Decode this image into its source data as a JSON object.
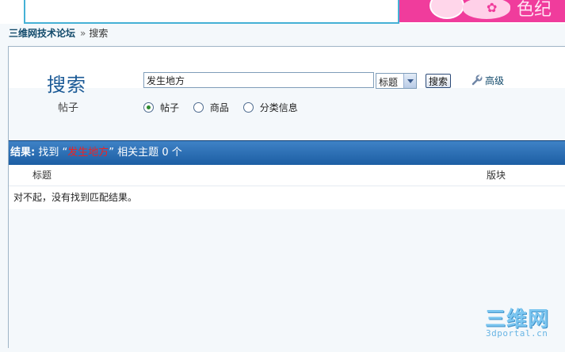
{
  "banner": {
    "right_text": "色纪佳"
  },
  "breadcrumb": {
    "forum": "三维网技术论坛",
    "separator": "»",
    "current": "搜索"
  },
  "search": {
    "title": "搜索",
    "subtitle": "帖子",
    "keyword": "发生地方",
    "field_selected": "标题",
    "button_label": "搜索",
    "advanced_label": "高级",
    "types": [
      {
        "label": "帖子",
        "checked": true
      },
      {
        "label": "商品",
        "checked": false
      },
      {
        "label": "分类信息",
        "checked": false
      }
    ]
  },
  "results": {
    "label": "结果:",
    "found": "找到",
    "open_quote": "“",
    "keyword": "发生地方",
    "close_quote": "”",
    "suffix": "相关主题",
    "count": "0",
    "unit": "个",
    "columns": {
      "title": "标题",
      "board": "版块"
    },
    "empty_message": "对不起，没有找到匹配结果。"
  },
  "watermark": {
    "cn": "三维网",
    "en": "3dportal.cn"
  }
}
